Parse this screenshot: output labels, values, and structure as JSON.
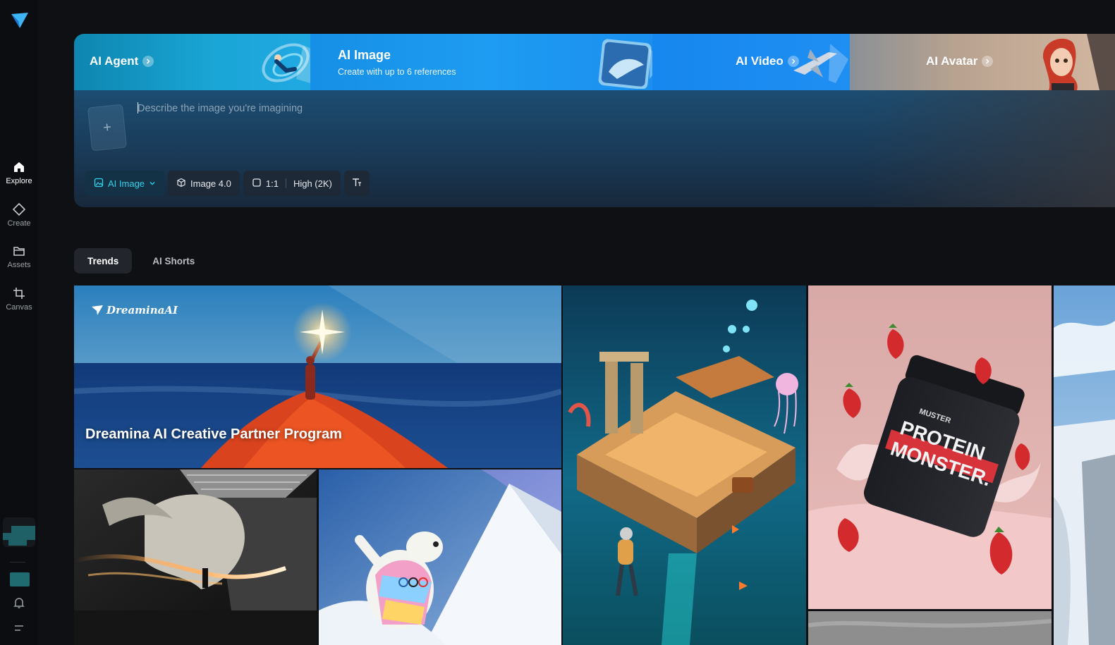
{
  "sidebar": {
    "items": [
      {
        "label": "Explore",
        "icon": "home-icon",
        "active": true
      },
      {
        "label": "Create",
        "icon": "diamond-icon",
        "active": false
      },
      {
        "label": "Assets",
        "icon": "folder-icon",
        "active": false
      },
      {
        "label": "Canvas",
        "icon": "crop-icon",
        "active": false
      }
    ]
  },
  "banner": {
    "agent": {
      "title": "AI Agent"
    },
    "image": {
      "title": "AI Image",
      "subtitle": "Create with up to 6 references"
    },
    "video": {
      "title": "AI Video"
    },
    "avatar": {
      "title": "AI Avatar"
    }
  },
  "prompt": {
    "placeholder": "Describe the image you're imagining",
    "add_icon": "plus-icon",
    "toolbar": {
      "mode": "AI Image",
      "model": "Image 4.0",
      "ratio": "1:1",
      "quality": "High (2K)"
    }
  },
  "tabs": [
    {
      "label": "Trends",
      "active": true
    },
    {
      "label": "AI Shorts",
      "active": false
    }
  ],
  "gallery": {
    "featured": {
      "brand": "DreaminaAI",
      "title": "Dreamina AI Creative Partner Program"
    },
    "product_label_1": "PROTEIN",
    "product_label_2": "MONSTER.",
    "product_brand": "MUSTER"
  },
  "colors": {
    "accent": "#2fd2e8",
    "background": "#0f1014",
    "banner_blue": "#1e9cf2"
  }
}
